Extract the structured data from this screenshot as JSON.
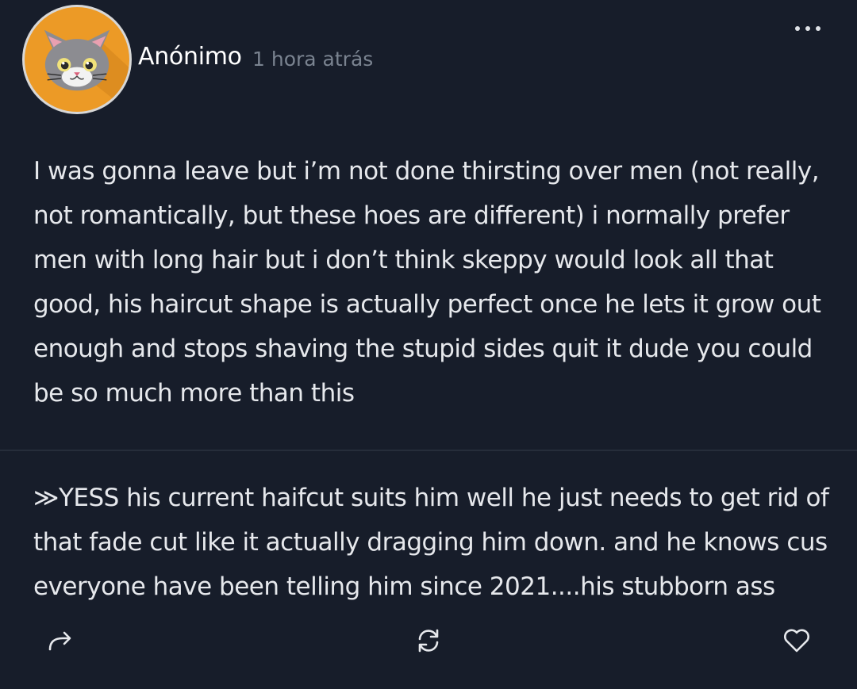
{
  "post": {
    "author": "Anónimo",
    "time": "1 hora atrás",
    "text": "I was gonna leave but i’m not done thirsting over men (not really, not romantically, but these hoes are different) i normally prefer men with long hair but i don’t think skeppy would look all that good, his haircut shape is actually perfect once he lets it grow out enough and stops shaving the stupid sides quit it dude you could be so much more than this"
  },
  "reply": {
    "text": "≫YESS his current haifcut suits him well he just needs to get rid of that fade cut like it actually dragging him down. and he knows cus everyone have been telling him since 2021....his stubborn ass"
  },
  "icons": {
    "avatar": "cat-avatar-icon",
    "more": "more-horizontal-icon",
    "share": "share-arrow-icon",
    "repost": "repost-icon",
    "like": "heart-icon"
  },
  "colors": {
    "background": "#171d2a",
    "text": "#e6e8ec",
    "muted": "#7a8390",
    "avatar_bg": "#ec9a26"
  }
}
